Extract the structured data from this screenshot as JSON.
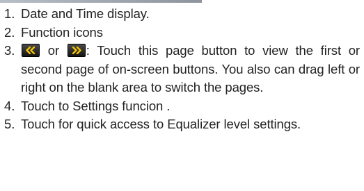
{
  "colors": {
    "text": "#222222",
    "page_button_bg": "#1e1e1e",
    "page_button_arrow": "#f5c200"
  },
  "icons": {
    "prev_page": "double-chevron-left-icon",
    "next_page": "double-chevron-right-icon"
  },
  "items": [
    {
      "num": "1.",
      "text": "Date and Time display."
    },
    {
      "num": "2.",
      "text": "Function icons"
    },
    {
      "num": "3.",
      "connector": " or ",
      "text": ": Touch this page button to view the first or second page of on-screen buttons. You also can drag left or right on the blank area to switch the pages."
    },
    {
      "num": "4.",
      "text": "Touch to Settings funcion ."
    },
    {
      "num": "5.",
      "text": "Touch for quick access to Equalizer level settings."
    }
  ]
}
